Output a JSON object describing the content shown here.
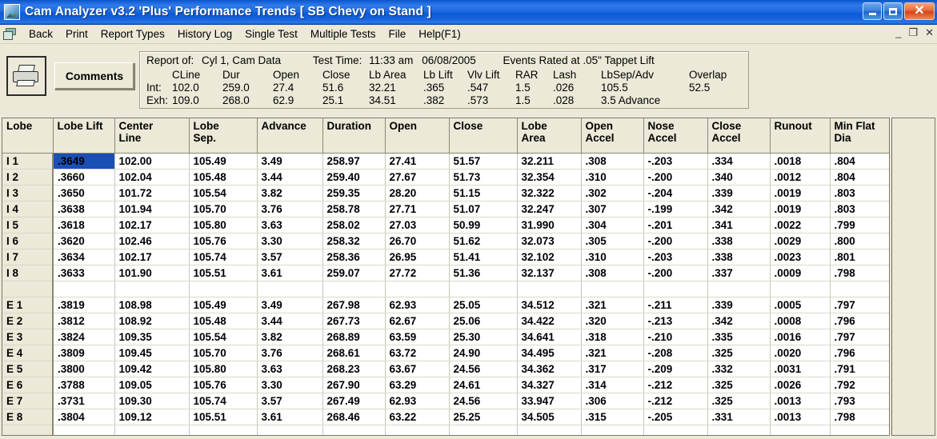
{
  "window": {
    "title": "Cam Analyzer v3.2 'Plus'  Performance Trends   [ SB Chevy on Stand ]",
    "minimize_label": "Minimize",
    "maximize_label": "Restore",
    "close_label": "Close"
  },
  "menubar": {
    "items": [
      {
        "label": "Back"
      },
      {
        "label": "Print"
      },
      {
        "label": "Report Types"
      },
      {
        "label": "History Log"
      },
      {
        "label": "Single Test"
      },
      {
        "label": "Multiple Tests"
      },
      {
        "label": "File"
      },
      {
        "label": "Help(F1)"
      }
    ],
    "mdi_minimize": "_",
    "mdi_restore": "❐",
    "mdi_close": "✕"
  },
  "toolbar": {
    "print_icon": "printer-icon",
    "comments_label": "Comments"
  },
  "report_header": {
    "report_of_label": "Report of:",
    "report_of_value": "Cyl 1, Cam Data",
    "test_time_label": "Test Time:",
    "test_time_value": "11:33 am",
    "test_date_value": "06/08/2005",
    "events_note": "Events Rated at .05\" Tappet Lift",
    "columns": [
      "CLine",
      "Dur",
      "Open",
      "Close",
      "Lb Area",
      "Lb Lift",
      "Vlv Lift",
      "RAR",
      "Lash",
      "LbSep/Adv",
      "Overlap"
    ],
    "rows": [
      {
        "label": "Int:",
        "values": [
          "102.0",
          "259.0",
          "27.4",
          "51.6",
          "32.21",
          ".365",
          ".547",
          "1.5",
          ".026",
          "105.5",
          "52.5"
        ]
      },
      {
        "label": "Exh:",
        "values": [
          "109.0",
          "268.0",
          "62.9",
          "25.1",
          "34.51",
          ".382",
          ".573",
          "1.5",
          ".028",
          "3.5 Advance",
          ""
        ]
      }
    ]
  },
  "table": {
    "columns": [
      "Lobe",
      "Lobe Lift",
      "Center\nLine",
      "Lobe\nSep.",
      "Advance",
      "Duration",
      "Open",
      "Close",
      "Lobe\nArea",
      "Open\nAccel",
      "Nose\nAccel",
      "Close\nAccel",
      "Runout",
      "Min Flat\nDia"
    ],
    "columns_display": [
      {
        "l1": "Lobe",
        "l2": ""
      },
      {
        "l1": "Lobe Lift",
        "l2": ""
      },
      {
        "l1": "Center",
        "l2": "Line"
      },
      {
        "l1": "Lobe",
        "l2": "Sep."
      },
      {
        "l1": "Advance",
        "l2": ""
      },
      {
        "l1": "Duration",
        "l2": ""
      },
      {
        "l1": "Open",
        "l2": ""
      },
      {
        "l1": "Close",
        "l2": ""
      },
      {
        "l1": "Lobe",
        "l2": "Area"
      },
      {
        "l1": "Open",
        "l2": "Accel"
      },
      {
        "l1": "Nose",
        "l2": "Accel"
      },
      {
        "l1": "Close",
        "l2": "Accel"
      },
      {
        "l1": "Runout",
        "l2": ""
      },
      {
        "l1": "Min Flat",
        "l2": "Dia"
      }
    ],
    "selected_cell": {
      "row": 0,
      "col": 1
    },
    "rows": [
      {
        "cells": [
          "I 1",
          ".3649",
          "102.00",
          "105.49",
          "3.49",
          "258.97",
          "27.41",
          "51.57",
          "32.211",
          ".308",
          "-.203",
          ".334",
          ".0018",
          ".804"
        ]
      },
      {
        "cells": [
          "I 2",
          ".3660",
          "102.04",
          "105.48",
          "3.44",
          "259.40",
          "27.67",
          "51.73",
          "32.354",
          ".310",
          "-.200",
          ".340",
          ".0012",
          ".804"
        ]
      },
      {
        "cells": [
          "I 3",
          ".3650",
          "101.72",
          "105.54",
          "3.82",
          "259.35",
          "28.20",
          "51.15",
          "32.322",
          ".302",
          "-.204",
          ".339",
          ".0019",
          ".803"
        ]
      },
      {
        "cells": [
          "I 4",
          ".3638",
          "101.94",
          "105.70",
          "3.76",
          "258.78",
          "27.71",
          "51.07",
          "32.247",
          ".307",
          "-.199",
          ".342",
          ".0019",
          ".803"
        ]
      },
      {
        "cells": [
          "I 5",
          ".3618",
          "102.17",
          "105.80",
          "3.63",
          "258.02",
          "27.03",
          "50.99",
          "31.990",
          ".304",
          "-.201",
          ".341",
          ".0022",
          ".799"
        ]
      },
      {
        "cells": [
          "I 6",
          ".3620",
          "102.46",
          "105.76",
          "3.30",
          "258.32",
          "26.70",
          "51.62",
          "32.073",
          ".305",
          "-.200",
          ".338",
          ".0029",
          ".800"
        ]
      },
      {
        "cells": [
          "I 7",
          ".3634",
          "102.17",
          "105.74",
          "3.57",
          "258.36",
          "26.95",
          "51.41",
          "32.102",
          ".310",
          "-.203",
          ".338",
          ".0023",
          ".801"
        ]
      },
      {
        "cells": [
          "I 8",
          ".3633",
          "101.90",
          "105.51",
          "3.61",
          "259.07",
          "27.72",
          "51.36",
          "32.137",
          ".308",
          "-.200",
          ".337",
          ".0009",
          ".798"
        ]
      },
      {
        "spacer": true,
        "cells": [
          "",
          "",
          "",
          "",
          "",
          "",
          "",
          "",
          "",
          "",
          "",
          "",
          "",
          ""
        ]
      },
      {
        "cells": [
          "E 1",
          ".3819",
          "108.98",
          "105.49",
          "3.49",
          "267.98",
          "62.93",
          "25.05",
          "34.512",
          ".321",
          "-.211",
          ".339",
          ".0005",
          ".797"
        ]
      },
      {
        "cells": [
          "E 2",
          ".3812",
          "108.92",
          "105.48",
          "3.44",
          "267.73",
          "62.67",
          "25.06",
          "34.422",
          ".320",
          "-.213",
          ".342",
          ".0008",
          ".796"
        ]
      },
      {
        "cells": [
          "E 3",
          ".3824",
          "109.35",
          "105.54",
          "3.82",
          "268.89",
          "63.59",
          "25.30",
          "34.641",
          ".318",
          "-.210",
          ".335",
          ".0016",
          ".797"
        ]
      },
      {
        "cells": [
          "E 4",
          ".3809",
          "109.45",
          "105.70",
          "3.76",
          "268.61",
          "63.72",
          "24.90",
          "34.495",
          ".321",
          "-.208",
          ".325",
          ".0020",
          ".796"
        ]
      },
      {
        "cells": [
          "E 5",
          ".3800",
          "109.42",
          "105.80",
          "3.63",
          "268.23",
          "63.67",
          "24.56",
          "34.362",
          ".317",
          "-.209",
          ".332",
          ".0031",
          ".791"
        ]
      },
      {
        "cells": [
          "E 6",
          ".3788",
          "109.05",
          "105.76",
          "3.30",
          "267.90",
          "63.29",
          "24.61",
          "34.327",
          ".314",
          "-.212",
          ".325",
          ".0026",
          ".792"
        ]
      },
      {
        "cells": [
          "E 7",
          ".3731",
          "109.30",
          "105.74",
          "3.57",
          "267.49",
          "62.93",
          "24.56",
          "33.947",
          ".306",
          "-.212",
          ".325",
          ".0013",
          ".793"
        ]
      },
      {
        "cells": [
          "E 8",
          ".3804",
          "109.12",
          "105.51",
          "3.61",
          "268.46",
          "63.22",
          "25.25",
          "34.505",
          ".315",
          "-.205",
          ".331",
          ".0013",
          ".798"
        ]
      },
      {
        "spacer": true,
        "cells": [
          "",
          "",
          "",
          "",
          "",
          "",
          "",
          "",
          "",
          "",
          "",
          "",
          "",
          ""
        ]
      }
    ]
  },
  "colors": {
    "titlebar_blue": "#1d6ae0",
    "selection_blue": "#1a4fb4",
    "chrome_beige": "#ece9d8",
    "close_red": "#d4441c"
  }
}
